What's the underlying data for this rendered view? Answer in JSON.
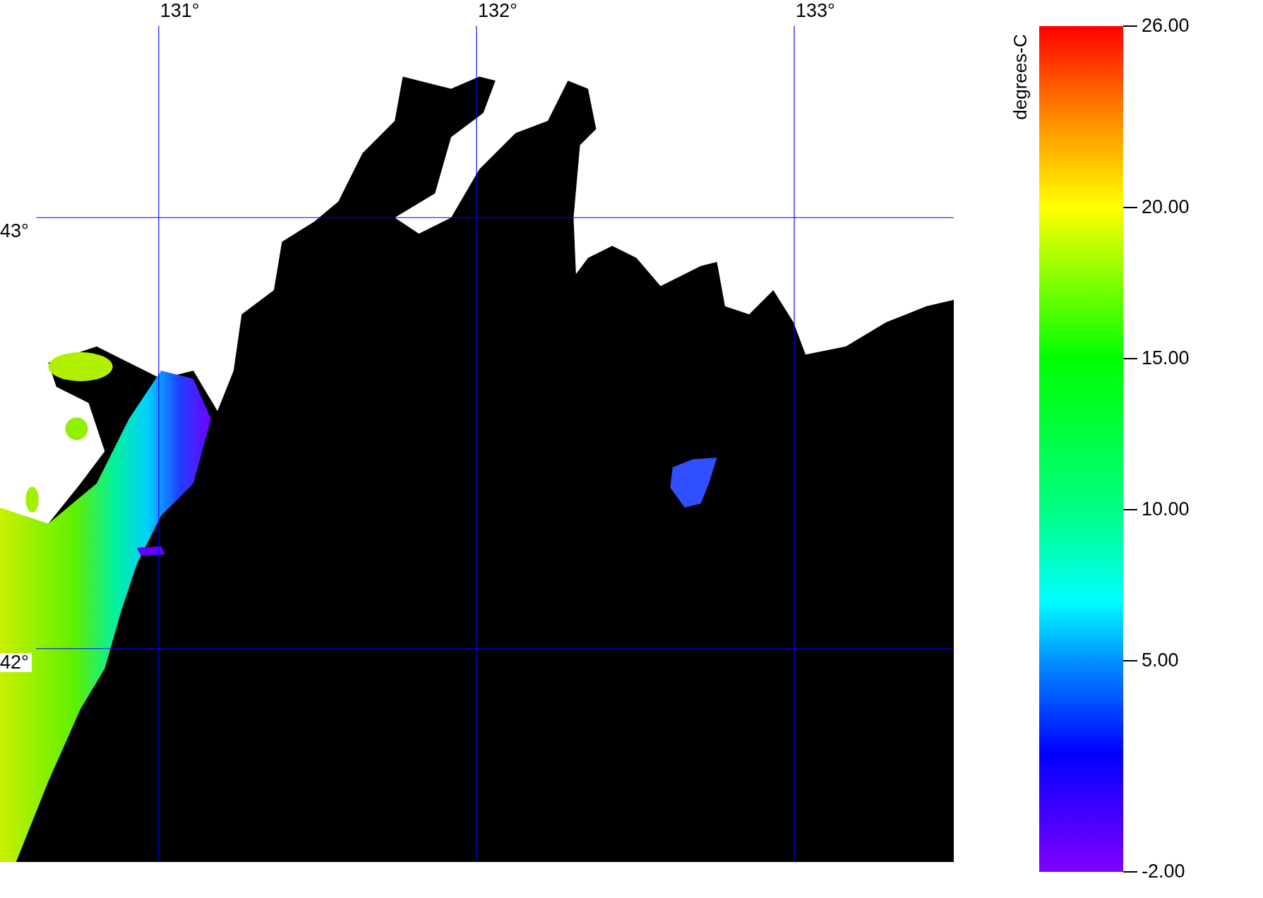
{
  "map": {
    "longitude_labels": [
      "131°",
      "132°",
      "133°"
    ],
    "latitude_labels": [
      "43°",
      "42°"
    ]
  },
  "colorbar": {
    "title": "degrees-C",
    "ticks": [
      "26.00",
      "20.00",
      "15.00",
      "10.00",
      "5.00",
      "-2.00"
    ]
  }
}
